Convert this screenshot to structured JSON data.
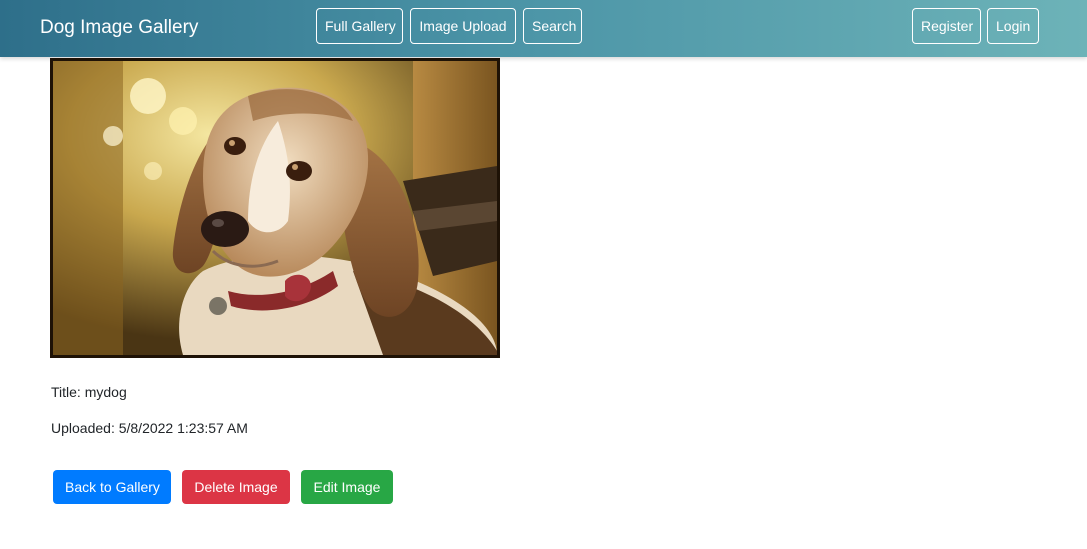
{
  "app": {
    "brand": "Dog Image Gallery"
  },
  "nav": {
    "full_gallery": "Full Gallery",
    "image_upload": "Image Upload",
    "search": "Search",
    "register": "Register",
    "login": "Login"
  },
  "image": {
    "title_text": "Title: mydog",
    "uploaded_text": "Uploaded: 5/8/2022 1:23:57 AM"
  },
  "actions": {
    "back": "Back to Gallery",
    "delete": "Delete Image",
    "edit": "Edit Image"
  },
  "colors": {
    "primary": "#007bff",
    "danger": "#dc3545",
    "success": "#28a745"
  }
}
